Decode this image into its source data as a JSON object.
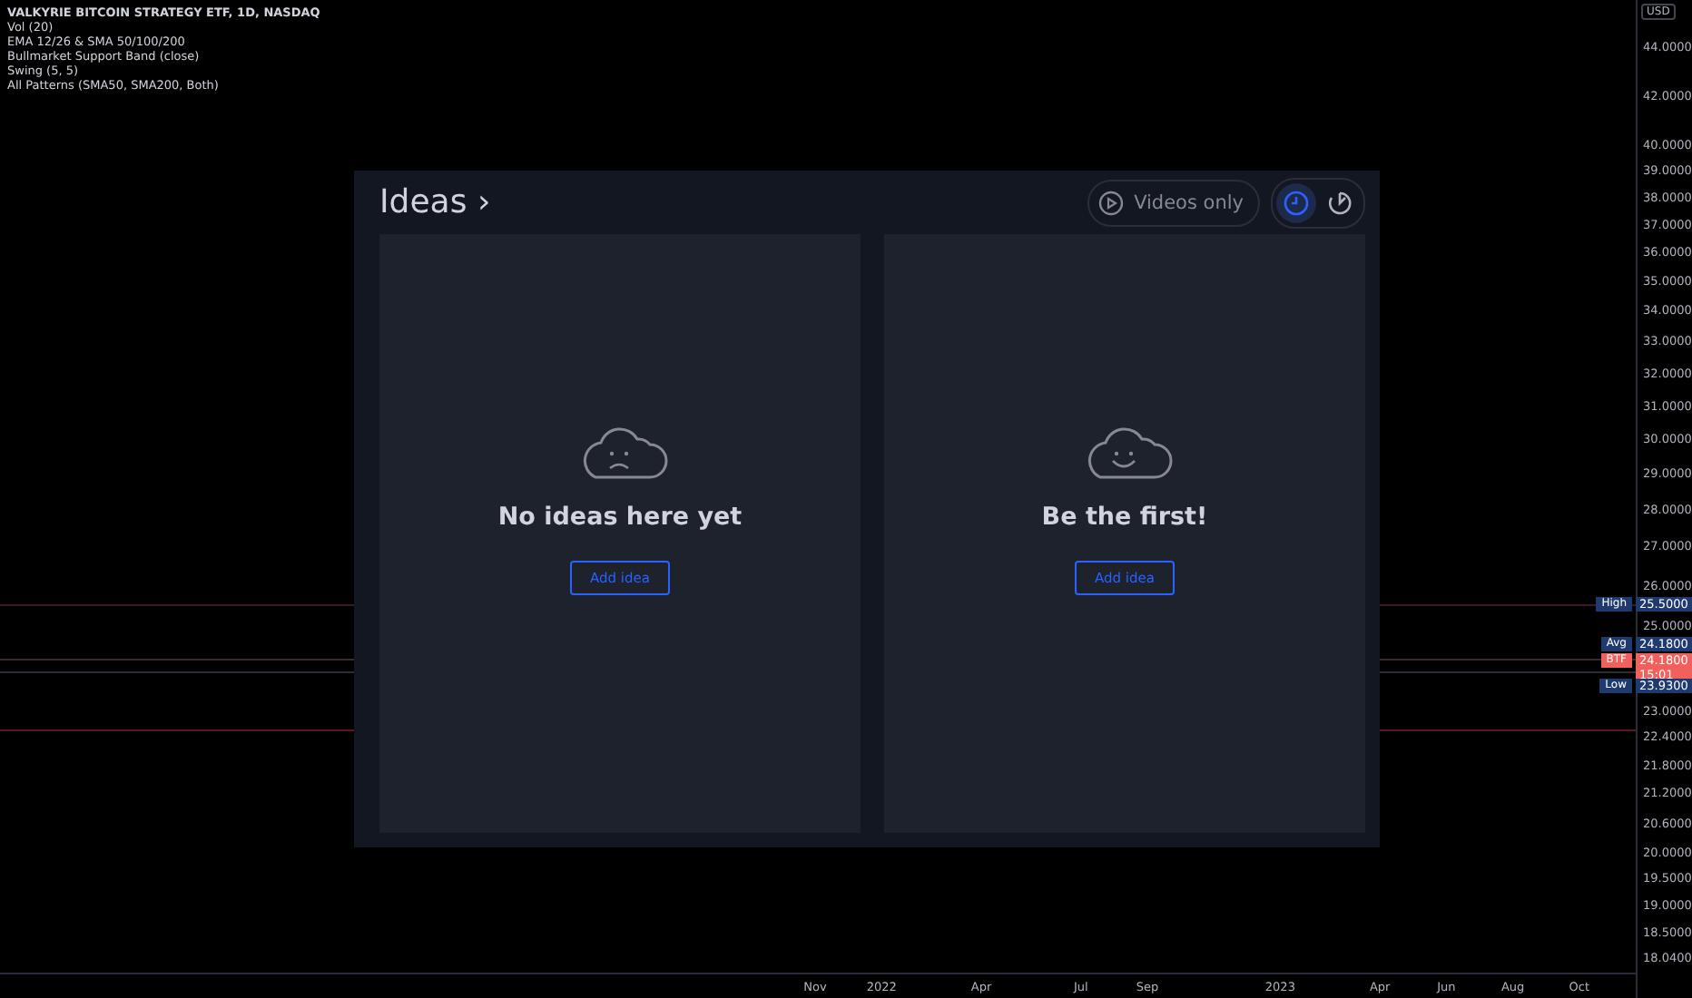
{
  "legend": [
    "VALKYRIE BITCOIN STRATEGY ETF, 1D, NASDAQ",
    "Vol (20)",
    "EMA 12/26 & SMA 50/100/200",
    "Bullmarket Support Band (close)",
    "Swing (5, 5)",
    "All Patterns (SMA50, SMA200, Both)"
  ],
  "price_axis": {
    "currency": "USD",
    "labels": [
      "44.0000",
      "42.0000",
      "40.0000",
      "39.0000",
      "38.0000",
      "37.0000",
      "36.0000",
      "35.0000",
      "34.0000",
      "33.0000",
      "32.0000",
      "31.0000",
      "30.0000",
      "29.0000",
      "28.0000",
      "27.0000",
      "26.0000",
      "25.0000",
      "23.0000",
      "22.4000",
      "21.8000",
      "21.2000",
      "20.6000",
      "20.0000",
      "19.5000",
      "19.0000",
      "18.5000",
      "18.0400"
    ],
    "markers": [
      {
        "kind": "level",
        "tag": "High",
        "value": "25.5000"
      },
      {
        "kind": "level",
        "tag": "Avg",
        "value": "24.1800"
      },
      {
        "kind": "last",
        "tag": "BTF",
        "value": "24.1800",
        "countdown": "15:01"
      },
      {
        "kind": "level",
        "tag": "Low",
        "value": "23.9300"
      }
    ]
  },
  "time_axis": [
    "Nov",
    "2022",
    "Apr",
    "Jul",
    "Sep",
    "2023",
    "Apr",
    "Jun",
    "Aug",
    "Oct"
  ],
  "ideas": {
    "title": "Ideas ›",
    "videos_only": "Videos only",
    "sort_toggles": [
      {
        "kind": "recent",
        "selected": true
      },
      {
        "kind": "popular",
        "selected": false
      }
    ],
    "cards": [
      {
        "kind": "sad",
        "message": "No ideas here yet",
        "button": "Add idea"
      },
      {
        "kind": "happy",
        "message": "Be the first!",
        "button": "Add idea"
      }
    ]
  }
}
